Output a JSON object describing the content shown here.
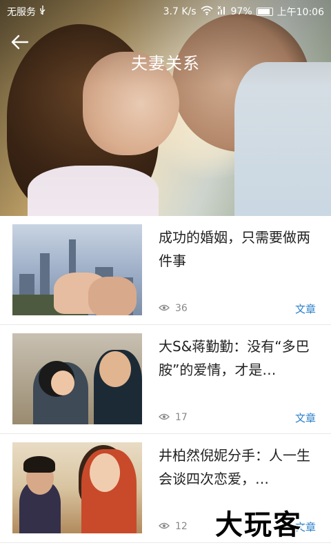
{
  "status": {
    "carrier": "无服务",
    "speed": "3.7 K/s",
    "battery": "97%",
    "time": "上午10:06"
  },
  "header": {
    "title": "夫妻关系"
  },
  "articles": [
    {
      "title": "成功的婚姻，只需要做两件事",
      "views": "36",
      "tag": "文章"
    },
    {
      "title": "大S&蒋勤勤：没有“多巴胺”的爱情，才是…",
      "views": "17",
      "tag": "文章"
    },
    {
      "title": "井柏然倪妮分手：人一生会谈四次恋爱，…",
      "views": "12",
      "tag": "文章"
    }
  ],
  "watermark": "大玩客",
  "colors": {
    "accent": "#2a7fc9",
    "divider": "#e8e8e8"
  }
}
